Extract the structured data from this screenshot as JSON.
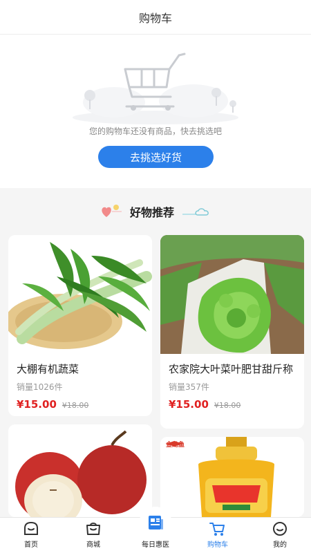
{
  "header": {
    "title": "购物车"
  },
  "empty_cart": {
    "message": "您的购物车还没有商品，快去挑选吧",
    "button_label": "去挑选好货"
  },
  "recommend": {
    "title": "好物推荐"
  },
  "products": [
    {
      "name": "大棚有机蔬菜",
      "sales": "销量1026件",
      "price": "¥15.00",
      "old_price": "¥18.00"
    },
    {
      "name": "农家院大叶菜叶肥甘甜斤称",
      "sales": "销量357件",
      "price": "¥15.00",
      "old_price": "¥18.00"
    },
    {
      "name": "",
      "sales": "",
      "price": "",
      "old_price": ""
    },
    {
      "name": "",
      "sales": "",
      "price": "",
      "old_price": "",
      "brand_label": "金龙鱼"
    }
  ],
  "tabbar": {
    "items": [
      {
        "label": "首页",
        "icon": "home-icon"
      },
      {
        "label": "商城",
        "icon": "shop-icon"
      },
      {
        "label": "每日惠医",
        "icon": "news-icon"
      },
      {
        "label": "购物车",
        "icon": "cart-icon"
      },
      {
        "label": "我的",
        "icon": "profile-icon"
      }
    ],
    "active_index": 3
  },
  "colors": {
    "accent": "#2c80ea",
    "price": "#e02020",
    "background": "#f5f5f5"
  }
}
